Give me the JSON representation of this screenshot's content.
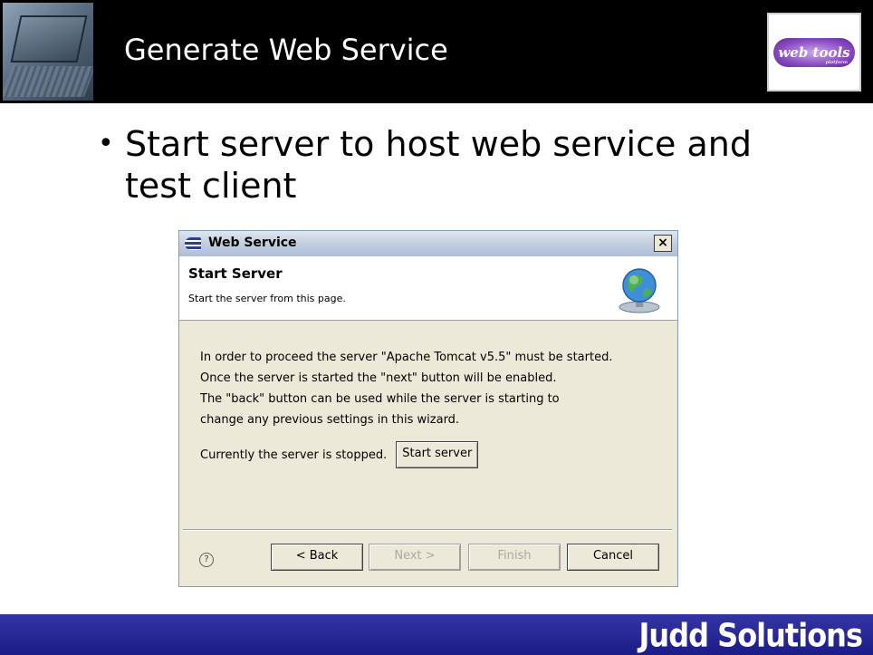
{
  "slide": {
    "title": "Generate Web Service",
    "bullet": "Start server to host web service and test client",
    "logo_text": "web tools",
    "logo_subtext": "platform",
    "footer_brand": "Judd Solutions"
  },
  "dialog": {
    "window_title": "Web Service",
    "close_label": "×",
    "page_title": "Start Server",
    "page_description": "Start the server from this page.",
    "message_lines": [
      "In order to proceed the server \"Apache Tomcat v5.5\" must be started.",
      "Once the server is started the \"next\" button will be enabled.",
      "The \"back\" button can be used while the server is starting to",
      "change any previous settings in this wizard."
    ],
    "status_text": "Currently the server is stopped.",
    "start_server_label": "Start server",
    "help_label": "?",
    "buttons": {
      "back": "< Back",
      "next": "Next >",
      "finish": "Finish",
      "cancel": "Cancel"
    }
  },
  "colors": {
    "header_bg": "#000000",
    "footer_bg": "#2a2a9a",
    "dialog_bg": "#ece9d8",
    "titlebar": "#c3cee0",
    "disabled_text": "#a9a9a9"
  },
  "icons": {
    "slide_corner": "laptop-image",
    "titlebar": "eclipse-icon",
    "banner": "globe-server-icon",
    "help": "help-icon"
  }
}
